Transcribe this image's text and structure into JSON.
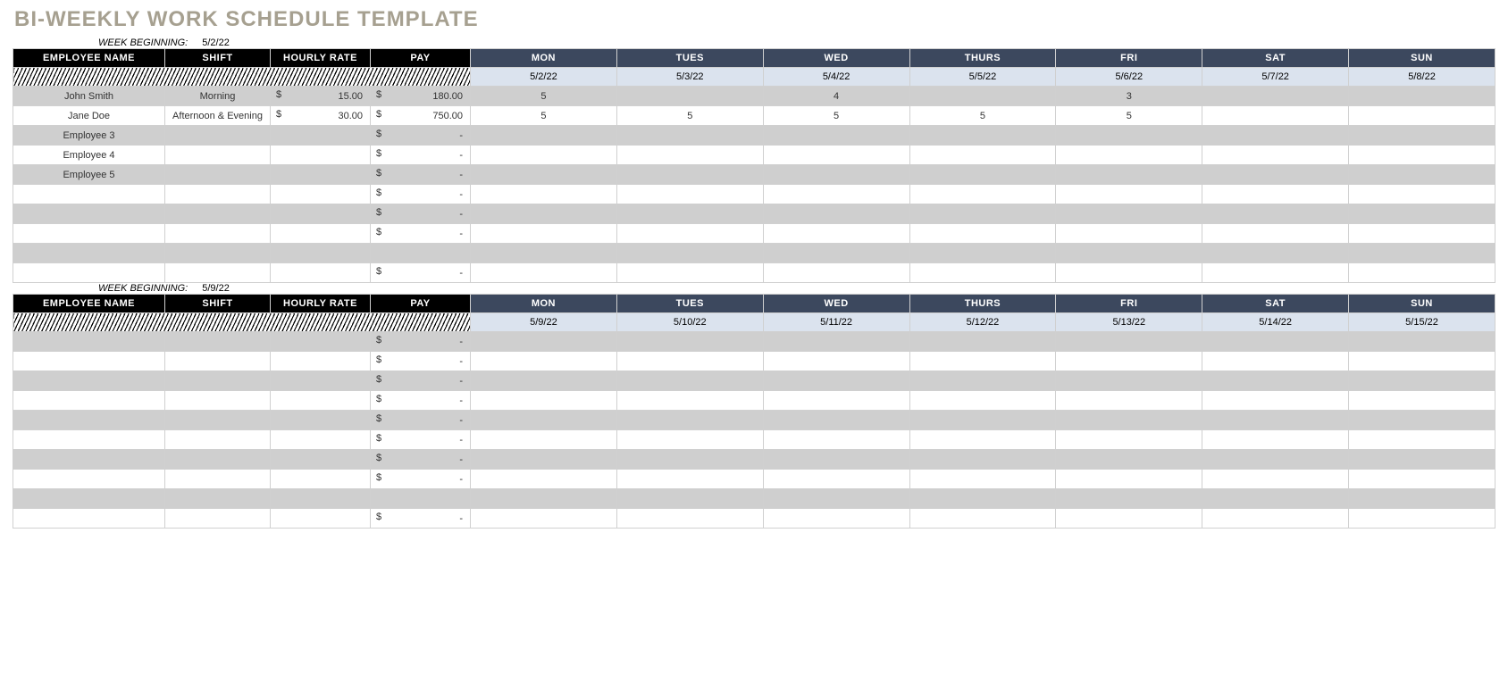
{
  "title": "BI-WEEKLY WORK SCHEDULE TEMPLATE",
  "week_beginning_label": "WEEK BEGINNING:",
  "headers": {
    "employee": "EMPLOYEE NAME",
    "shift": "SHIFT",
    "rate": "HOURLY RATE",
    "pay": "PAY",
    "days": [
      "MON",
      "TUES",
      "WED",
      "THURS",
      "FRI",
      "SAT",
      "SUN"
    ]
  },
  "dollar": "$",
  "dash": "-",
  "weeks": [
    {
      "beginning": "5/2/22",
      "dates": [
        "5/2/22",
        "5/3/22",
        "5/4/22",
        "5/5/22",
        "5/6/22",
        "5/7/22",
        "5/8/22"
      ],
      "rows": [
        {
          "name": "John Smith",
          "shift": "Morning",
          "rate": "15.00",
          "pay": "180.00",
          "days": [
            "5",
            "",
            "4",
            "",
            "3",
            "",
            ""
          ],
          "grey": true
        },
        {
          "name": "Jane Doe",
          "shift": "Afternoon & Evening",
          "rate": "30.00",
          "pay": "750.00",
          "days": [
            "5",
            "5",
            "5",
            "5",
            "5",
            "",
            ""
          ],
          "grey": false
        },
        {
          "name": "Employee 3",
          "shift": "",
          "rate": "",
          "pay": "-",
          "days": [
            "",
            "",
            "",
            "",
            "",
            "",
            ""
          ],
          "grey": true
        },
        {
          "name": "Employee 4",
          "shift": "",
          "rate": "",
          "pay": "-",
          "days": [
            "",
            "",
            "",
            "",
            "",
            "",
            ""
          ],
          "grey": false
        },
        {
          "name": "Employee 5",
          "shift": "",
          "rate": "",
          "pay": "-",
          "days": [
            "",
            "",
            "",
            "",
            "",
            "",
            ""
          ],
          "grey": true
        },
        {
          "name": "",
          "shift": "",
          "rate": "",
          "pay": "-",
          "days": [
            "",
            "",
            "",
            "",
            "",
            "",
            ""
          ],
          "grey": false
        },
        {
          "name": "",
          "shift": "",
          "rate": "",
          "pay": "-",
          "days": [
            "",
            "",
            "",
            "",
            "",
            "",
            ""
          ],
          "grey": true
        },
        {
          "name": "",
          "shift": "",
          "rate": "",
          "pay": "-",
          "days": [
            "",
            "",
            "",
            "",
            "",
            "",
            ""
          ],
          "grey": false
        },
        {
          "name": "",
          "shift": "",
          "rate": "",
          "pay": "",
          "days": [
            "",
            "",
            "",
            "",
            "",
            "",
            ""
          ],
          "grey": true,
          "nodollar": true
        },
        {
          "name": "",
          "shift": "",
          "rate": "",
          "pay": "-",
          "days": [
            "",
            "",
            "",
            "",
            "",
            "",
            ""
          ],
          "grey": false
        }
      ]
    },
    {
      "beginning": "5/9/22",
      "dates": [
        "5/9/22",
        "5/10/22",
        "5/11/22",
        "5/12/22",
        "5/13/22",
        "5/14/22",
        "5/15/22"
      ],
      "rows": [
        {
          "name": "",
          "shift": "",
          "rate": "",
          "pay": "-",
          "days": [
            "",
            "",
            "",
            "",
            "",
            "",
            ""
          ],
          "grey": true
        },
        {
          "name": "",
          "shift": "",
          "rate": "",
          "pay": "-",
          "days": [
            "",
            "",
            "",
            "",
            "",
            "",
            ""
          ],
          "grey": false
        },
        {
          "name": "",
          "shift": "",
          "rate": "",
          "pay": "-",
          "days": [
            "",
            "",
            "",
            "",
            "",
            "",
            ""
          ],
          "grey": true
        },
        {
          "name": "",
          "shift": "",
          "rate": "",
          "pay": "-",
          "days": [
            "",
            "",
            "",
            "",
            "",
            "",
            ""
          ],
          "grey": false
        },
        {
          "name": "",
          "shift": "",
          "rate": "",
          "pay": "-",
          "days": [
            "",
            "",
            "",
            "",
            "",
            "",
            ""
          ],
          "grey": true
        },
        {
          "name": "",
          "shift": "",
          "rate": "",
          "pay": "-",
          "days": [
            "",
            "",
            "",
            "",
            "",
            "",
            ""
          ],
          "grey": false
        },
        {
          "name": "",
          "shift": "",
          "rate": "",
          "pay": "-",
          "days": [
            "",
            "",
            "",
            "",
            "",
            "",
            ""
          ],
          "grey": true
        },
        {
          "name": "",
          "shift": "",
          "rate": "",
          "pay": "-",
          "days": [
            "",
            "",
            "",
            "",
            "",
            "",
            ""
          ],
          "grey": false
        },
        {
          "name": "",
          "shift": "",
          "rate": "",
          "pay": "",
          "days": [
            "",
            "",
            "",
            "",
            "",
            "",
            ""
          ],
          "grey": true,
          "nodollar": true
        },
        {
          "name": "",
          "shift": "",
          "rate": "",
          "pay": "-",
          "days": [
            "",
            "",
            "",
            "",
            "",
            "",
            ""
          ],
          "grey": false
        }
      ]
    }
  ]
}
